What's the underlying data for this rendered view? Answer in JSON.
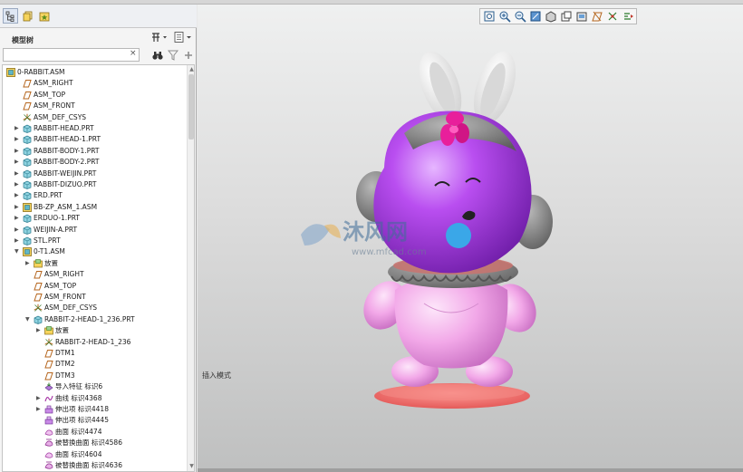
{
  "navigator": {
    "tabs": [
      {
        "icon": "model-tree-icon"
      },
      {
        "icon": "folder-browser-icon"
      },
      {
        "icon": "favorites-icon"
      }
    ],
    "tree_title": "模型树",
    "search": {
      "value": "",
      "placeholder": "",
      "clear_glyph": "×"
    }
  },
  "tree": [
    {
      "label": "0-RABBIT.ASM",
      "icon": "assembly-icon",
      "level": 0,
      "expander": ""
    },
    {
      "label": "ASM_RIGHT",
      "icon": "datum-plane-icon",
      "level": 1,
      "expander": ""
    },
    {
      "label": "ASM_TOP",
      "icon": "datum-plane-icon",
      "level": 1,
      "expander": ""
    },
    {
      "label": "ASM_FRONT",
      "icon": "datum-plane-icon",
      "level": 1,
      "expander": ""
    },
    {
      "label": "ASM_DEF_CSYS",
      "icon": "csys-icon",
      "level": 1,
      "expander": ""
    },
    {
      "label": "RABBIT-HEAD.PRT",
      "icon": "part-icon",
      "level": 1,
      "expander": "▶"
    },
    {
      "label": "RABBIT-HEAD-1.PRT",
      "icon": "part-icon",
      "level": 1,
      "expander": "▶"
    },
    {
      "label": "RABBIT-BODY-1.PRT",
      "icon": "part-icon",
      "level": 1,
      "expander": "▶"
    },
    {
      "label": "RABBIT-BODY-2.PRT",
      "icon": "part-icon",
      "level": 1,
      "expander": "▶"
    },
    {
      "label": "RABBIT-WEIJIN.PRT",
      "icon": "part-icon",
      "level": 1,
      "expander": "▶"
    },
    {
      "label": "RABBIT-DIZUO.PRT",
      "icon": "part-icon",
      "level": 1,
      "expander": "▶"
    },
    {
      "label": "ERD.PRT",
      "icon": "part-icon",
      "level": 1,
      "expander": "▶"
    },
    {
      "label": "BB-ZP_ASM_1.ASM",
      "icon": "assembly-icon",
      "level": 1,
      "expander": "▶"
    },
    {
      "label": "ERDUO-1.PRT",
      "icon": "part-icon",
      "level": 1,
      "expander": "▶"
    },
    {
      "label": "WEIJIN-A.PRT",
      "icon": "part-icon",
      "level": 1,
      "expander": "▶"
    },
    {
      "label": "STL.PRT",
      "icon": "part-icon",
      "level": 1,
      "expander": "▶"
    },
    {
      "label": "0-T1.ASM",
      "icon": "assembly-icon",
      "level": 1,
      "expander": "▼"
    },
    {
      "label": "放置",
      "icon": "placement-icon",
      "level": 2,
      "expander": "▶"
    },
    {
      "label": "ASM_RIGHT",
      "icon": "datum-plane-icon",
      "level": 2,
      "expander": ""
    },
    {
      "label": "ASM_TOP",
      "icon": "datum-plane-icon",
      "level": 2,
      "expander": ""
    },
    {
      "label": "ASM_FRONT",
      "icon": "datum-plane-icon",
      "level": 2,
      "expander": ""
    },
    {
      "label": "ASM_DEF_CSYS",
      "icon": "csys-icon",
      "level": 2,
      "expander": ""
    },
    {
      "label": "RABBIT-2-HEAD-1_236.PRT",
      "icon": "part-icon",
      "level": 2,
      "expander": "▼"
    },
    {
      "label": "放置",
      "icon": "placement-icon",
      "level": 3,
      "expander": "▶"
    },
    {
      "label": "RABBIT-2-HEAD-1_236",
      "icon": "csys-icon",
      "level": 3,
      "expander": ""
    },
    {
      "label": "DTM1",
      "icon": "datum-plane-icon",
      "level": 3,
      "expander": ""
    },
    {
      "label": "DTM2",
      "icon": "datum-plane-icon",
      "level": 3,
      "expander": ""
    },
    {
      "label": "DTM3",
      "icon": "datum-plane-icon",
      "level": 3,
      "expander": ""
    },
    {
      "label": "导入特征 标识6",
      "icon": "import-feature-icon",
      "level": 3,
      "expander": ""
    },
    {
      "label": "曲线 标识4368",
      "icon": "curve-icon",
      "level": 3,
      "expander": "▶"
    },
    {
      "label": "伸出项 标识4418",
      "icon": "protrusion-icon",
      "level": 3,
      "expander": "▶"
    },
    {
      "label": "伸出项 标识4445",
      "icon": "protrusion-icon",
      "level": 3,
      "expander": ""
    },
    {
      "label": "曲面 标识4474",
      "icon": "surface-icon",
      "level": 3,
      "expander": ""
    },
    {
      "label": "被替换曲面 标识4586",
      "icon": "replaced-surface-icon",
      "level": 3,
      "expander": ""
    },
    {
      "label": "曲面 标识4604",
      "icon": "surface-icon",
      "level": 3,
      "expander": ""
    },
    {
      "label": "被替换曲面 标识4636",
      "icon": "replaced-surface-icon",
      "level": 3,
      "expander": ""
    }
  ],
  "graphics": {
    "mode_text": "插入模式",
    "view_toolbar": [
      "refit-icon",
      "zoom-in-icon",
      "zoom-out-icon",
      "repaint-icon",
      "display-style-icon",
      "saved-views-icon",
      "view-manager-icon",
      "datum-display-icon",
      "spin-center-icon",
      "annotation-display-icon"
    ],
    "watermark": {
      "brand": "沐风网",
      "url": "www.mfcad.com"
    }
  },
  "colors": {
    "model_purple": "#b344e8",
    "model_pink": "#f2a7e6",
    "base_red": "#f0706e",
    "ears_white": "#f7f7f7",
    "bow_magenta": "#e81f9b",
    "collar_gray": "#7a7a7a"
  }
}
